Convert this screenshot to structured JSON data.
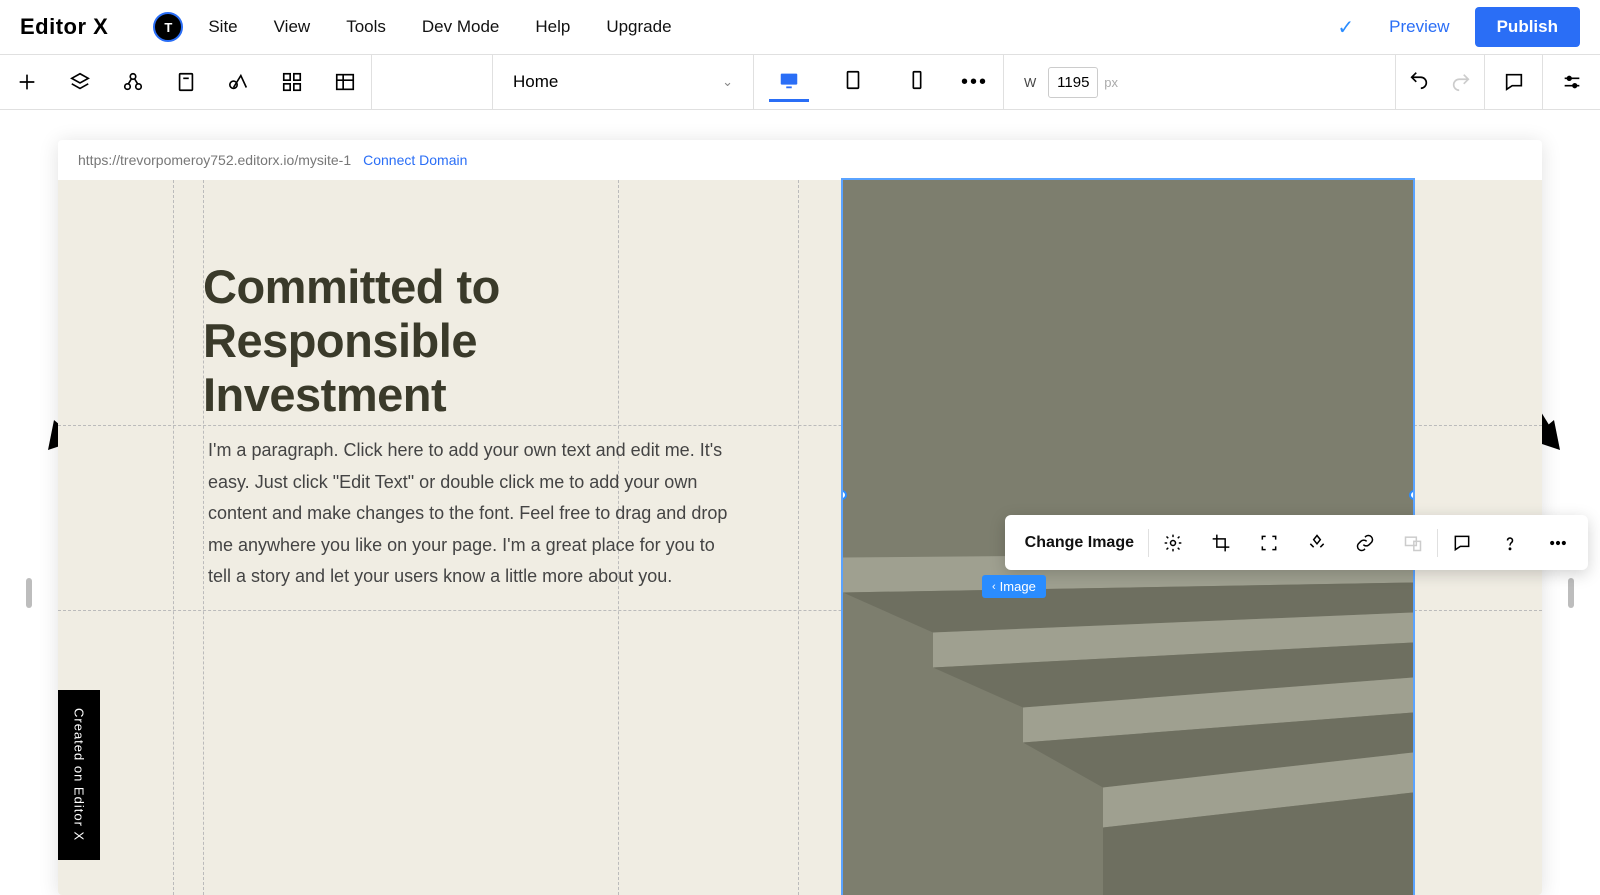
{
  "brand": "Editor X",
  "avatar_initial": "T",
  "menu": {
    "site": "Site",
    "view": "View",
    "tools": "Tools",
    "dev_mode": "Dev Mode",
    "help": "Help",
    "upgrade": "Upgrade"
  },
  "actions": {
    "preview": "Preview",
    "publish": "Publish"
  },
  "page_selector": {
    "current": "Home"
  },
  "width_control": {
    "label": "W",
    "value": "1195",
    "unit": "px"
  },
  "canvas": {
    "url": "https://trevorpomeroy752.editorx.io/mysite-1",
    "connect_domain": "Connect Domain",
    "heading": "Committed to Responsible Investment",
    "paragraph": "I'm a paragraph. Click here to add your own text and edit me. It's easy. Just click \"Edit Text\" or double click me to add your own content and make changes to the font. Feel free to drag and drop me anywhere you like on your page. I'm a great place for you to tell a story and let your users know a little more about you."
  },
  "image_toolbar": {
    "change": "Change Image"
  },
  "breadcrumb_chip": "Image",
  "made_tag": "Created on Editor X"
}
